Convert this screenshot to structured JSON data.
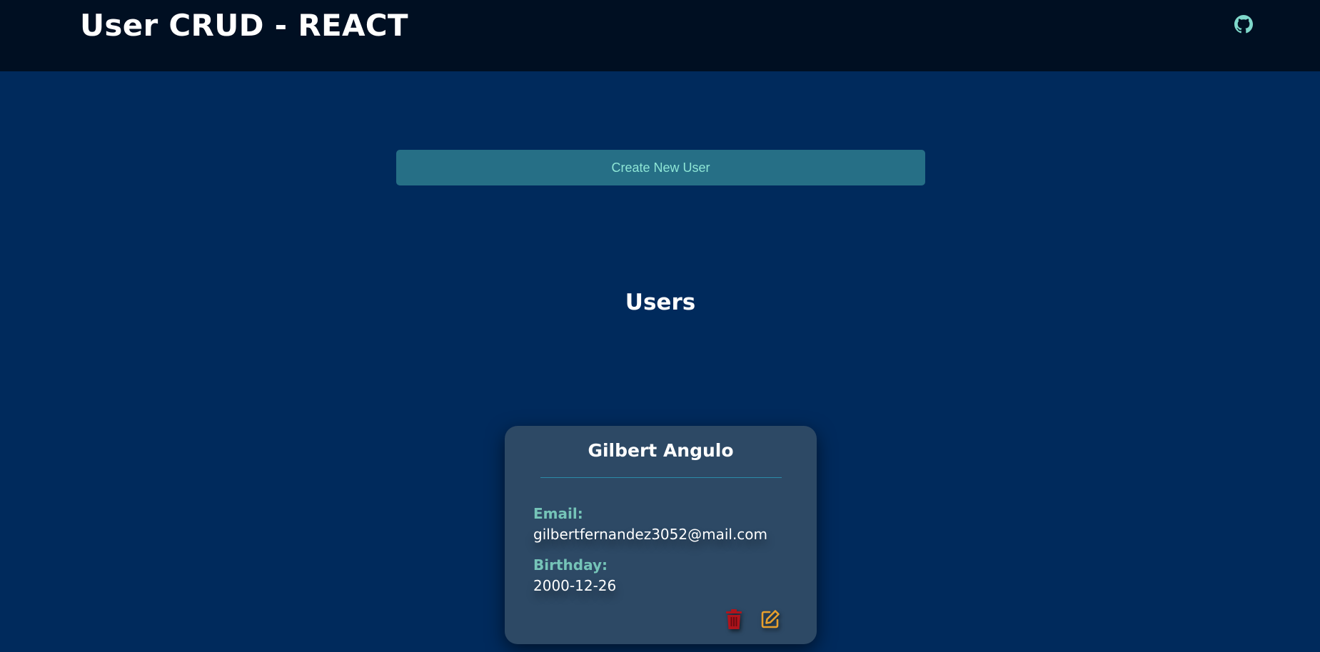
{
  "header": {
    "title": "User CRUD - REACT",
    "github_icon": "github-icon"
  },
  "actions": {
    "create_label": "Create New User"
  },
  "users_section": {
    "title": "Users"
  },
  "user_card": {
    "name": "Gilbert Angulo",
    "email_label": "Email:",
    "email": "gilbertfernandez3052@mail.com",
    "birthday_label": "Birthday:",
    "birthday": "2000-12-26",
    "delete_icon": "trash-icon",
    "edit_icon": "edit-icon"
  },
  "colors": {
    "page_background": "#002a5c",
    "header_background": "#000f22",
    "button_background": "#266f86",
    "button_text": "#8ee6d6",
    "card_background": "#2d4965",
    "label_accent": "#75c4b8",
    "delete_color": "#b0141c",
    "edit_color": "#e8a02c"
  }
}
